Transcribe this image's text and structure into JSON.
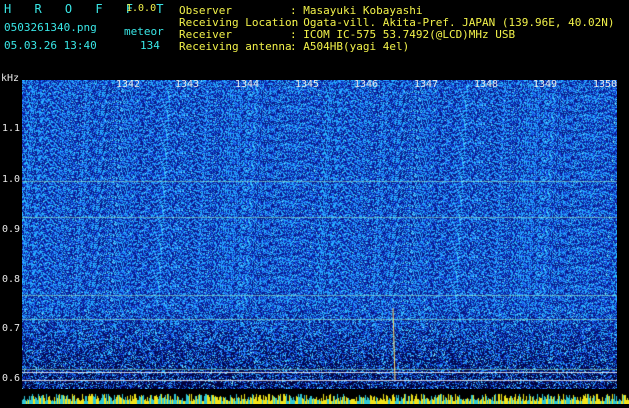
{
  "header": {
    "app_name": "H R O F F T",
    "version": "1.0.0",
    "filename": "0503261340.png",
    "mode_label": "meteor",
    "datetime": "05.03.26 13:40",
    "count": "134",
    "fields": [
      {
        "label": "Observer",
        "value": ": Masayuki Kobayashi"
      },
      {
        "label": "Receiving Location",
        "value": ": Ogata-vill. Akita-Pref. JAPAN (139.96E, 40.02N)"
      },
      {
        "label": "Receiver",
        "value": ": ICOM IC-575 53.7492(@LCD)MHz USB"
      },
      {
        "label": "Receiving antenna",
        "value": ": A504HB(yagi 4el)"
      }
    ]
  },
  "spectrogram": {
    "y_unit": "kHz",
    "y_ticks": [
      "1.1",
      "1.0",
      "0.9",
      "0.8",
      "0.7",
      "0.6"
    ],
    "x_ticks": [
      "1342",
      "1343",
      "1344",
      "1345",
      "1346",
      "1347",
      "1348",
      "1349",
      "1350"
    ],
    "colors": {
      "background": "#0b1d8c",
      "noise_low": "#0a1a80",
      "noise_high": "#3cc8ff",
      "line": "#9ff0c8",
      "text_cyan": "#39e6e6",
      "text_yellow": "#f2f24a"
    }
  }
}
